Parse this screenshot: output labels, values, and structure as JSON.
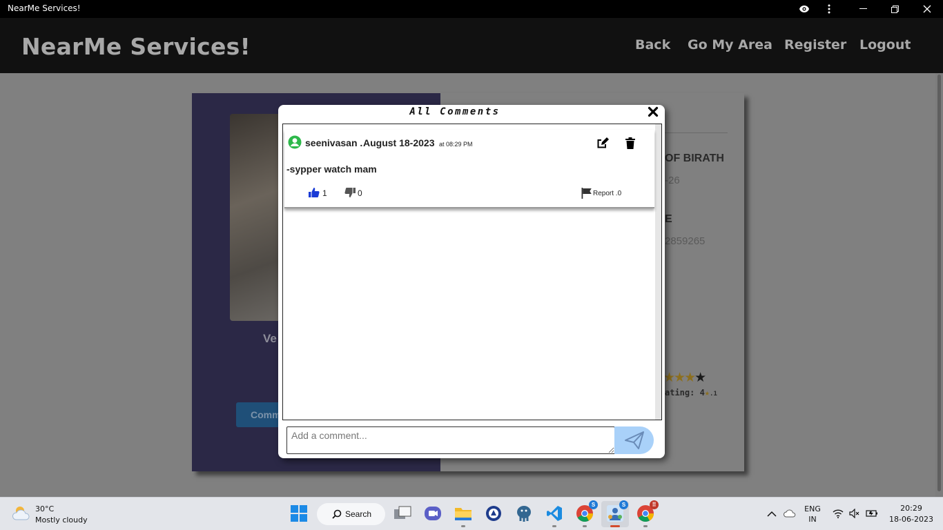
{
  "window": {
    "title": "NearMe Services!"
  },
  "navbar": {
    "brand": "NearMe Services!",
    "links": [
      "Back",
      "Go My Area",
      "Register",
      "Logout"
    ]
  },
  "profile": {
    "name_partial": "Ve",
    "comment_button": "Comm",
    "dob_label_partial": "OF BIRATH",
    "dob_value_partial": "-26",
    "phone_label_partial": "E",
    "phone_value_partial": "2859265",
    "rating_partial": "ating: 4",
    "rating_suffix": ".1",
    "stars": {
      "filled": 4,
      "total": 5
    }
  },
  "modal": {
    "title": "All Comments",
    "comments": [
      {
        "author": "seenivasan .",
        "date": "August 18-2023",
        "time": "at 08:29 PM",
        "text": "-sypper watch mam",
        "likes": "1",
        "dislikes": "0",
        "report": "Report .0"
      }
    ],
    "input_placeholder": "Add a comment..."
  },
  "taskbar": {
    "weather_temp": "30°C",
    "weather_cond": "Mostly cloudy",
    "search_label": "Search",
    "lang_top": "ENG",
    "lang_bottom": "IN",
    "time": "20:29",
    "date": "18-06-2023"
  },
  "colors": {
    "like_blue": "#1a3bd6",
    "avatar_green": "#2db84a",
    "send_bg": "#a9d1f9"
  }
}
